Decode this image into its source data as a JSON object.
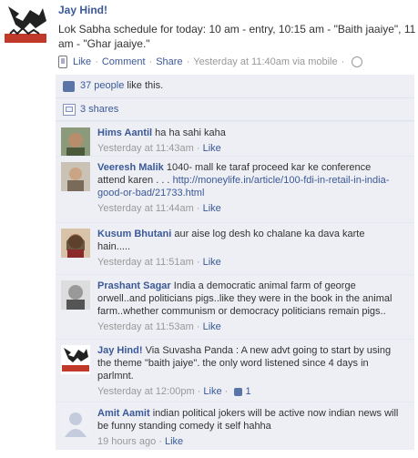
{
  "post": {
    "author": "Jay Hind!",
    "text_lines": [
      "Lok Sabha schedule for today: 10 am - entry, 10:15 am - \"Baith jaaiye\", 11",
      "am - \"Ghar jaaiye.\""
    ],
    "actions": {
      "like": "Like",
      "comment": "Comment",
      "share": "Share",
      "timestamp": "Yesterday at 11:40am via mobile"
    }
  },
  "likes": {
    "count_link": "37 people",
    "suffix": "like this."
  },
  "shares": {
    "label": "3 shares"
  },
  "comments": [
    {
      "name": "Hims Aantil",
      "text_lines": [
        "ha ha sahi kaha"
      ],
      "time": "Yesterday at 11:43am",
      "like": "Like"
    },
    {
      "name": "Veeresh Malik",
      "text_lines": [
        "1040- mall ke taraf proceed kar ke conference"
      ],
      "text2_plain": "attend karen . . .",
      "link_lines": [
        "http://moneylife.in/article/100-fdi-in-retail-in-india-",
        "good-or-bad/21733.html"
      ],
      "time": "Yesterday at 11:44am",
      "like": "Like"
    },
    {
      "name": "Kusum Bhutani",
      "text_lines": [
        "aur aise log desh ko chalane ka dava karte",
        "hain....."
      ],
      "time": "Yesterday at 11:51am",
      "like": "Like"
    },
    {
      "name": "Prashant Sagar",
      "text_lines": [
        "India a democratic animal farm of george",
        "orwell..and politicians pigs..like they were in the book in the animal",
        "farm..whether communism or democracy politicians remain pigs.."
      ],
      "time": "Yesterday at 11:53am",
      "like": "Like"
    },
    {
      "name": "Jay Hind!",
      "text_lines": [
        "Via Suvasha Panda : A new advt going to start by using",
        "the theme \"baith jaiye\". the only word listened since 4 days in",
        "parlmnt."
      ],
      "time": "Yesterday at 12:00pm",
      "like": "Like",
      "like_count": "1"
    },
    {
      "name": "Amit Aamit",
      "text_lines": [
        "indian political jokers will be active now indian news will",
        "be funny standing comedy it self hahha"
      ],
      "time": "19 hours ago",
      "like": "Like"
    }
  ]
}
